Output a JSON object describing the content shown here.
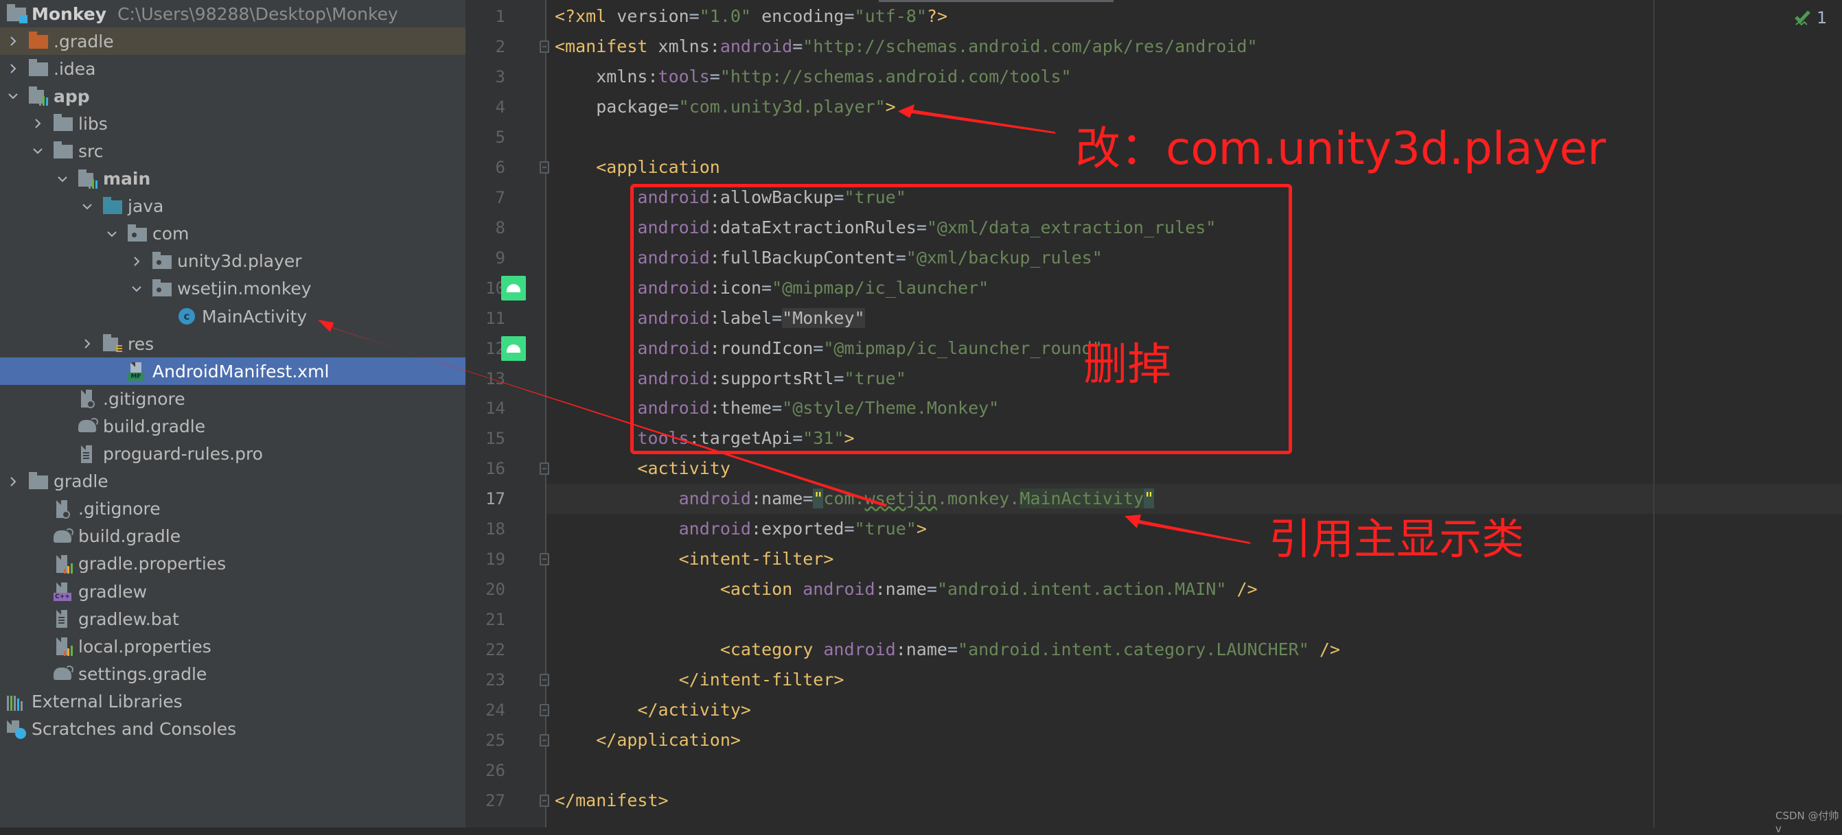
{
  "project": {
    "name": "Monkey",
    "path": "C:\\Users\\98288\\Desktop\\Monkey"
  },
  "tree": [
    {
      "label": ".gradle",
      "depth": 0,
      "chevron": "right",
      "icon": "folder-orange",
      "state": "highlight"
    },
    {
      "label": ".idea",
      "depth": 0,
      "chevron": "right",
      "icon": "folder"
    },
    {
      "label": "app",
      "depth": 0,
      "chevron": "down",
      "icon": "module-folder",
      "bold": true
    },
    {
      "label": "libs",
      "depth": 1,
      "chevron": "right",
      "icon": "folder"
    },
    {
      "label": "src",
      "depth": 1,
      "chevron": "down",
      "icon": "folder"
    },
    {
      "label": "main",
      "depth": 2,
      "chevron": "down",
      "icon": "module-folder",
      "bold": true
    },
    {
      "label": "java",
      "depth": 3,
      "chevron": "down",
      "icon": "folder-blue"
    },
    {
      "label": "com",
      "depth": 4,
      "chevron": "down",
      "icon": "package-folder"
    },
    {
      "label": "unity3d.player",
      "depth": 5,
      "chevron": "right",
      "icon": "package-folder"
    },
    {
      "label": "wsetjin.monkey",
      "depth": 5,
      "chevron": "down",
      "icon": "package-folder"
    },
    {
      "label": "MainActivity",
      "depth": 6,
      "chevron": "none",
      "icon": "class"
    },
    {
      "label": "res",
      "depth": 3,
      "chevron": "right",
      "icon": "res-folder"
    },
    {
      "label": "AndroidManifest.xml",
      "depth": 4,
      "chevron": "none",
      "icon": "manifest",
      "state": "selected"
    },
    {
      "label": ".gitignore",
      "depth": 2,
      "chevron": "none",
      "icon": "gitignore"
    },
    {
      "label": "build.gradle",
      "depth": 2,
      "chevron": "none",
      "icon": "gradle"
    },
    {
      "label": "proguard-rules.pro",
      "depth": 2,
      "chevron": "none",
      "icon": "text-file"
    },
    {
      "label": "gradle",
      "depth": 0,
      "chevron": "right",
      "icon": "folder"
    },
    {
      "label": ".gitignore",
      "depth": 1,
      "chevron": "none",
      "icon": "gitignore"
    },
    {
      "label": "build.gradle",
      "depth": 1,
      "chevron": "none",
      "icon": "gradle"
    },
    {
      "label": "gradle.properties",
      "depth": 1,
      "chevron": "none",
      "icon": "properties"
    },
    {
      "label": "gradlew",
      "depth": 1,
      "chevron": "none",
      "icon": "shell-script"
    },
    {
      "label": "gradlew.bat",
      "depth": 1,
      "chevron": "none",
      "icon": "text-file"
    },
    {
      "label": "local.properties",
      "depth": 1,
      "chevron": "none",
      "icon": "properties"
    },
    {
      "label": "settings.gradle",
      "depth": 1,
      "chevron": "none",
      "icon": "gradle"
    },
    {
      "label": "External Libraries",
      "depth": -1,
      "chevron": "none",
      "icon": "libraries"
    },
    {
      "label": "Scratches and Consoles",
      "depth": -1,
      "chevron": "none",
      "icon": "scratches"
    }
  ],
  "editor": {
    "current_line": 17,
    "inspection_count": "1",
    "gutter_android_icons_lines": [
      10,
      12
    ],
    "fold_lines": [
      2,
      6,
      16,
      19,
      23,
      24,
      25,
      27
    ],
    "lines": [
      [
        {
          "c": "t",
          "s": "<?xml "
        },
        {
          "c": "at",
          "s": "version"
        },
        {
          "c": "p",
          "s": "="
        },
        {
          "c": "v",
          "s": "\"1.0\""
        },
        {
          "c": "p",
          "s": " "
        },
        {
          "c": "at",
          "s": "encoding"
        },
        {
          "c": "p",
          "s": "="
        },
        {
          "c": "v",
          "s": "\"utf-8\""
        },
        {
          "c": "t",
          "s": "?>"
        }
      ],
      [
        {
          "c": "t",
          "s": "<manifest "
        },
        {
          "c": "at",
          "s": "xmlns:"
        },
        {
          "c": "ns",
          "s": "android"
        },
        {
          "c": "p",
          "s": "="
        },
        {
          "c": "v",
          "s": "\"http://schemas.android.com/apk/res/android\""
        }
      ],
      [
        {
          "c": "p",
          "s": "    "
        },
        {
          "c": "at",
          "s": "xmlns:"
        },
        {
          "c": "ns",
          "s": "tools"
        },
        {
          "c": "p",
          "s": "="
        },
        {
          "c": "v",
          "s": "\"http://schemas.android.com/tools\""
        }
      ],
      [
        {
          "c": "p",
          "s": "    "
        },
        {
          "c": "at",
          "s": "package"
        },
        {
          "c": "p",
          "s": "="
        },
        {
          "c": "v",
          "s": "\"com.unity3d.player\""
        },
        {
          "c": "t",
          "s": ">"
        }
      ],
      [],
      [
        {
          "c": "p",
          "s": "    "
        },
        {
          "c": "t",
          "s": "<application"
        }
      ],
      [
        {
          "c": "p",
          "s": "        "
        },
        {
          "c": "ns",
          "s": "android"
        },
        {
          "c": "at",
          "s": ":allowBackup"
        },
        {
          "c": "p",
          "s": "="
        },
        {
          "c": "v",
          "s": "\"true\""
        }
      ],
      [
        {
          "c": "p",
          "s": "        "
        },
        {
          "c": "ns",
          "s": "android"
        },
        {
          "c": "at",
          "s": ":dataExtractionRules"
        },
        {
          "c": "p",
          "s": "="
        },
        {
          "c": "v",
          "s": "\"@xml/data_extraction_rules\""
        }
      ],
      [
        {
          "c": "p",
          "s": "        "
        },
        {
          "c": "ns",
          "s": "android"
        },
        {
          "c": "at",
          "s": ":fullBackupContent"
        },
        {
          "c": "p",
          "s": "="
        },
        {
          "c": "v",
          "s": "\"@xml/backup_rules\""
        }
      ],
      [
        {
          "c": "p",
          "s": "        "
        },
        {
          "c": "ns",
          "s": "android"
        },
        {
          "c": "at",
          "s": ":icon"
        },
        {
          "c": "p",
          "s": "="
        },
        {
          "c": "v",
          "s": "\"@mipmap/ic_launcher\""
        }
      ],
      [
        {
          "c": "p",
          "s": "        "
        },
        {
          "c": "ns",
          "s": "android"
        },
        {
          "c": "at",
          "s": ":label"
        },
        {
          "c": "p",
          "s": "="
        },
        {
          "c": "at lbl-bg",
          "s": "\"Monkey\""
        }
      ],
      [
        {
          "c": "p",
          "s": "        "
        },
        {
          "c": "ns",
          "s": "android"
        },
        {
          "c": "at",
          "s": ":roundIcon"
        },
        {
          "c": "p",
          "s": "="
        },
        {
          "c": "v",
          "s": "\"@mipmap/ic_launcher_round\""
        }
      ],
      [
        {
          "c": "p",
          "s": "        "
        },
        {
          "c": "ns",
          "s": "android"
        },
        {
          "c": "at",
          "s": ":supportsRtl"
        },
        {
          "c": "p",
          "s": "="
        },
        {
          "c": "v",
          "s": "\"true\""
        }
      ],
      [
        {
          "c": "p",
          "s": "        "
        },
        {
          "c": "ns",
          "s": "android"
        },
        {
          "c": "at",
          "s": ":theme"
        },
        {
          "c": "p",
          "s": "="
        },
        {
          "c": "v",
          "s": "\"@style/Theme.Monkey\""
        }
      ],
      [
        {
          "c": "p",
          "s": "        "
        },
        {
          "c": "ns",
          "s": "tools"
        },
        {
          "c": "at",
          "s": ":targetApi"
        },
        {
          "c": "p",
          "s": "="
        },
        {
          "c": "v",
          "s": "\"31\""
        },
        {
          "c": "t",
          "s": ">"
        }
      ],
      [
        {
          "c": "p",
          "s": "        "
        },
        {
          "c": "t",
          "s": "<activity"
        }
      ],
      [
        {
          "c": "p",
          "s": "            "
        },
        {
          "c": "ns",
          "s": "android"
        },
        {
          "c": "at",
          "s": ":name"
        },
        {
          "c": "p",
          "s": "="
        },
        {
          "c": "qbrace",
          "s": "\""
        },
        {
          "c": "v",
          "s": "com."
        },
        {
          "c": "v squig",
          "s": "wsetjin"
        },
        {
          "c": "v",
          "s": ".monkey."
        },
        {
          "c": "v qhl",
          "s": "MainActivity"
        },
        {
          "c": "qbrace",
          "s": "\""
        }
      ],
      [
        {
          "c": "p",
          "s": "            "
        },
        {
          "c": "ns",
          "s": "android"
        },
        {
          "c": "at",
          "s": ":exported"
        },
        {
          "c": "p",
          "s": "="
        },
        {
          "c": "v",
          "s": "\"true\""
        },
        {
          "c": "t",
          "s": ">"
        }
      ],
      [
        {
          "c": "p",
          "s": "            "
        },
        {
          "c": "t",
          "s": "<intent-filter>"
        }
      ],
      [
        {
          "c": "p",
          "s": "                "
        },
        {
          "c": "t",
          "s": "<action "
        },
        {
          "c": "ns",
          "s": "android"
        },
        {
          "c": "at",
          "s": ":name"
        },
        {
          "c": "p",
          "s": "="
        },
        {
          "c": "v",
          "s": "\"android.intent.action.MAIN\""
        },
        {
          "c": "p",
          "s": " "
        },
        {
          "c": "t",
          "s": "/>"
        }
      ],
      [],
      [
        {
          "c": "p",
          "s": "                "
        },
        {
          "c": "t",
          "s": "<category "
        },
        {
          "c": "ns",
          "s": "android"
        },
        {
          "c": "at",
          "s": ":name"
        },
        {
          "c": "p",
          "s": "="
        },
        {
          "c": "v",
          "s": "\"android.intent.category.LAUNCHER\""
        },
        {
          "c": "p",
          "s": " "
        },
        {
          "c": "t",
          "s": "/>"
        }
      ],
      [
        {
          "c": "p",
          "s": "            "
        },
        {
          "c": "t",
          "s": "</intent-filter>"
        }
      ],
      [
        {
          "c": "p",
          "s": "        "
        },
        {
          "c": "t",
          "s": "</activity>"
        }
      ],
      [
        {
          "c": "p",
          "s": "    "
        },
        {
          "c": "t",
          "s": "</application>"
        }
      ],
      [],
      [
        {
          "c": "t",
          "s": "</manifest>"
        }
      ]
    ]
  },
  "annotations": {
    "change_package": "改：com.unity3d.player",
    "delete_block": "删掉",
    "reference_main_class": "引用主显示类",
    "color": "#ff1f1f"
  },
  "watermark": "CSDN @付帅v",
  "colors": {
    "sidebar_bg": "#3c3f41",
    "editor_bg": "#2b2b2b",
    "selection": "#4b6eaf",
    "tag": "#e8bf6a",
    "namespace": "#9876aa",
    "value": "#6a8759"
  }
}
